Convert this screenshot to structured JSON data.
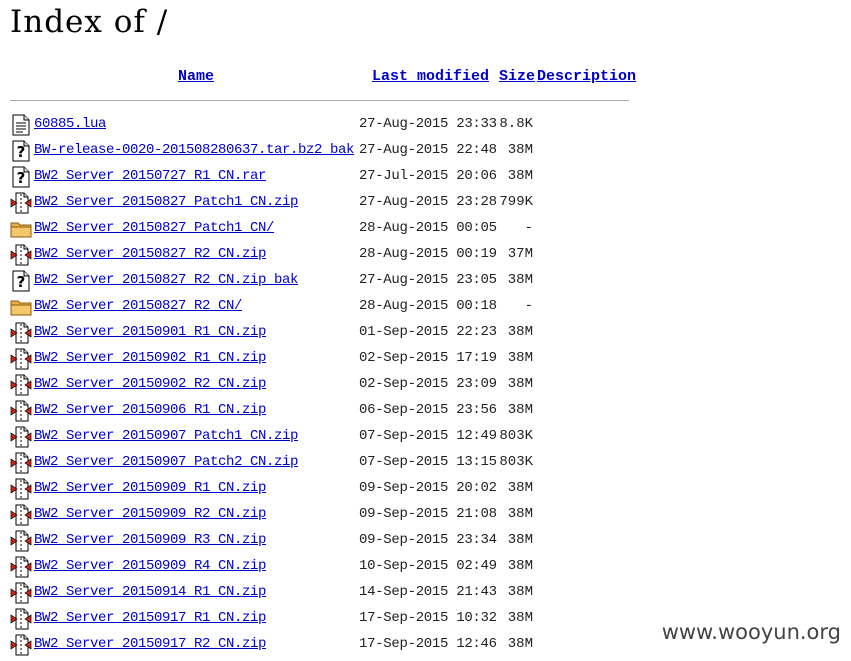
{
  "page": {
    "title": "Index of /"
  },
  "columns": {
    "name": "Name",
    "last_modified": "Last modified",
    "size": "Size",
    "description": "Description"
  },
  "entries": [
    {
      "icon": "text-file-icon",
      "name": "60885.lua",
      "modified": "27-Aug-2015 23:33",
      "size": "8.8K"
    },
    {
      "icon": "unknown-file-icon",
      "name": "BW-release-0020-201508280637.tar.bz2_bak",
      "modified": "27-Aug-2015 22:48",
      "size": "38M"
    },
    {
      "icon": "unknown-file-icon",
      "name": "BW2_Server_20150727_R1_CN.rar",
      "modified": "27-Jul-2015 20:06",
      "size": "38M"
    },
    {
      "icon": "compressed-file-icon",
      "name": "BW2_Server_20150827_Patch1_CN.zip",
      "modified": "27-Aug-2015 23:28",
      "size": "799K"
    },
    {
      "icon": "folder-icon",
      "name": "BW2_Server_20150827_Patch1_CN/",
      "modified": "28-Aug-2015 00:05",
      "size": "-"
    },
    {
      "icon": "compressed-file-icon",
      "name": "BW2_Server_20150827_R2_CN.zip",
      "modified": "28-Aug-2015 00:19",
      "size": "37M"
    },
    {
      "icon": "unknown-file-icon",
      "name": "BW2_Server_20150827_R2_CN.zip_bak",
      "modified": "27-Aug-2015 23:05",
      "size": "38M"
    },
    {
      "icon": "folder-icon",
      "name": "BW2_Server_20150827_R2_CN/",
      "modified": "28-Aug-2015 00:18",
      "size": "-"
    },
    {
      "icon": "compressed-file-icon",
      "name": "BW2_Server_20150901_R1_CN.zip",
      "modified": "01-Sep-2015 22:23",
      "size": "38M"
    },
    {
      "icon": "compressed-file-icon",
      "name": "BW2_Server_20150902_R1_CN.zip",
      "modified": "02-Sep-2015 17:19",
      "size": "38M"
    },
    {
      "icon": "compressed-file-icon",
      "name": "BW2_Server_20150902_R2_CN.zip",
      "modified": "02-Sep-2015 23:09",
      "size": "38M"
    },
    {
      "icon": "compressed-file-icon",
      "name": "BW2_Server_20150906_R1_CN.zip",
      "modified": "06-Sep-2015 23:56",
      "size": "38M"
    },
    {
      "icon": "compressed-file-icon",
      "name": "BW2_Server_20150907_Patch1_CN.zip",
      "modified": "07-Sep-2015 12:49",
      "size": "803K"
    },
    {
      "icon": "compressed-file-icon",
      "name": "BW2_Server_20150907_Patch2_CN.zip",
      "modified": "07-Sep-2015 13:15",
      "size": "803K"
    },
    {
      "icon": "compressed-file-icon",
      "name": "BW2_Server_20150909_R1_CN.zip",
      "modified": "09-Sep-2015 20:02",
      "size": "38M"
    },
    {
      "icon": "compressed-file-icon",
      "name": "BW2_Server_20150909_R2_CN.zip",
      "modified": "09-Sep-2015 21:08",
      "size": "38M"
    },
    {
      "icon": "compressed-file-icon",
      "name": "BW2_Server_20150909_R3_CN.zip",
      "modified": "09-Sep-2015 23:34",
      "size": "38M"
    },
    {
      "icon": "compressed-file-icon",
      "name": "BW2_Server_20150909_R4_CN.zip",
      "modified": "10-Sep-2015 02:49",
      "size": "38M"
    },
    {
      "icon": "compressed-file-icon",
      "name": "BW2_Server_20150914_R1_CN.zip",
      "modified": "14-Sep-2015 21:43",
      "size": "38M"
    },
    {
      "icon": "compressed-file-icon",
      "name": "BW2_Server_20150917_R1_CN.zip",
      "modified": "17-Sep-2015 10:32",
      "size": "38M"
    },
    {
      "icon": "compressed-file-icon",
      "name": "BW2_Server_20150917_R2_CN.zip",
      "modified": "17-Sep-2015 12:46",
      "size": "38M"
    }
  ],
  "watermark": "www.wooyun.org",
  "colors": {
    "link": "#0000cc",
    "rule": "#aaaaaa",
    "folder": "#e8b04a",
    "compressed_red": "#cc2222"
  }
}
